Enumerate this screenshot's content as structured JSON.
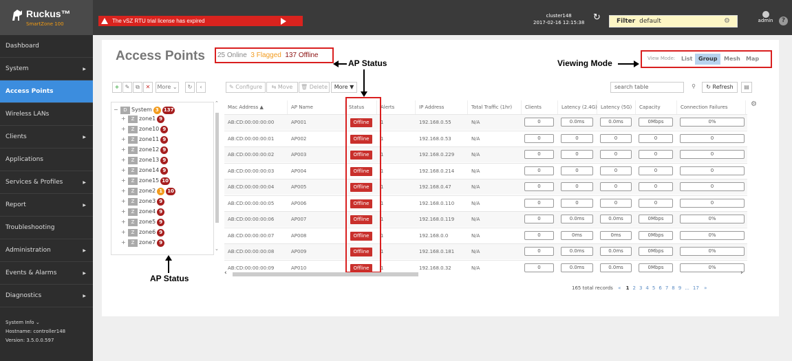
{
  "app": {
    "brand": "Ruckus™",
    "product": "SmartZone 100"
  },
  "alert": {
    "text": "The vSZ RTU trial license has expired"
  },
  "header": {
    "cluster": "cluster148",
    "datetime": "2017-02-16 12:15:38",
    "filter_label": "Filter",
    "filter_value": "default",
    "user": "admin"
  },
  "sidebar": {
    "items": [
      {
        "label": "Dashboard",
        "arrow": false
      },
      {
        "label": "System",
        "arrow": true
      },
      {
        "label": "Access Points",
        "arrow": false,
        "active": true
      },
      {
        "label": "Wireless LANs",
        "arrow": false
      },
      {
        "label": "Clients",
        "arrow": true
      },
      {
        "label": "Applications",
        "arrow": false
      },
      {
        "label": "Services & Profiles",
        "arrow": true
      },
      {
        "label": "Report",
        "arrow": true
      },
      {
        "label": "Troubleshooting",
        "arrow": false
      },
      {
        "label": "Administration",
        "arrow": true
      },
      {
        "label": "Events & Alarms",
        "arrow": true
      },
      {
        "label": "Diagnostics",
        "arrow": true
      }
    ],
    "sysinfo": {
      "title": "System Info",
      "hostname": "Hostname: controller148",
      "version": "Version:  3.5.0.0.597"
    }
  },
  "page": {
    "title": "Access Points",
    "online": "25 Online",
    "flagged": "3 Flagged",
    "offline": "137 Offline"
  },
  "annotations": {
    "ap_status_top": "AP Status",
    "ap_status_bottom": "AP Status",
    "viewing_mode": "Viewing Mode"
  },
  "view_mode": {
    "label": "View Mode:",
    "options": [
      "List",
      "Group",
      "Mesh",
      "Map"
    ],
    "selected": "Group"
  },
  "tree_toolbar": {
    "more": "More"
  },
  "tree": {
    "root": {
      "tag": "D",
      "name": "System",
      "flagged": "3",
      "offline": "137"
    },
    "zones": [
      {
        "name": "zone1",
        "flagged": "",
        "offline": "9"
      },
      {
        "name": "zone10",
        "flagged": "",
        "offline": "9"
      },
      {
        "name": "zone11",
        "flagged": "",
        "offline": "9"
      },
      {
        "name": "zone12",
        "flagged": "",
        "offline": "9"
      },
      {
        "name": "zone13",
        "flagged": "",
        "offline": "9"
      },
      {
        "name": "zone14",
        "flagged": "",
        "offline": "9"
      },
      {
        "name": "zone15",
        "flagged": "",
        "offline": "10"
      },
      {
        "name": "zone2",
        "flagged": "1",
        "offline": "10"
      },
      {
        "name": "zone3",
        "flagged": "",
        "offline": "9"
      },
      {
        "name": "zone4",
        "flagged": "",
        "offline": "9"
      },
      {
        "name": "zone5",
        "flagged": "",
        "offline": "9"
      },
      {
        "name": "zone6",
        "flagged": "",
        "offline": "9"
      },
      {
        "name": "zone7",
        "flagged": "",
        "offline": "9"
      }
    ]
  },
  "table_toolbar": {
    "configure": "Configure",
    "move": "Move",
    "delete": "Delete",
    "more": "More ▼",
    "search_placeholder": "search table",
    "refresh": "Refresh"
  },
  "table": {
    "headers": [
      "Mac Address ▲",
      "AP Name",
      "Status",
      "Alerts",
      "IP Address",
      "Total Traffic (1hr)",
      "Clients",
      "Latency (2.4G)",
      "Latency (5G)",
      "Capacity",
      "Connection Failures"
    ],
    "rows": [
      [
        "AB:CD:00:00:00:00",
        "AP001",
        "Offline",
        "1",
        "192.168.0.55",
        "N/A",
        "0",
        "0.0ms",
        "0.0ms",
        "0Mbps",
        "0%"
      ],
      [
        "AB:CD:00:00:00:01",
        "AP002",
        "Offline",
        "1",
        "192.168.0.53",
        "N/A",
        "0",
        "0",
        "0",
        "0",
        "0"
      ],
      [
        "AB:CD:00:00:00:02",
        "AP003",
        "Offline",
        "1",
        "192.168.0.229",
        "N/A",
        "0",
        "0",
        "0",
        "0",
        "0"
      ],
      [
        "AB:CD:00:00:00:03",
        "AP004",
        "Offline",
        "1",
        "192.168.0.214",
        "N/A",
        "0",
        "0",
        "0",
        "0",
        "0"
      ],
      [
        "AB:CD:00:00:00:04",
        "AP005",
        "Offline",
        "1",
        "192.168.0.47",
        "N/A",
        "0",
        "0",
        "0",
        "0",
        "0"
      ],
      [
        "AB:CD:00:00:00:05",
        "AP006",
        "Offline",
        "1",
        "192.168.0.110",
        "N/A",
        "0",
        "0",
        "0",
        "0",
        "0"
      ],
      [
        "AB:CD:00:00:00:06",
        "AP007",
        "Offline",
        "1",
        "192.168.0.119",
        "N/A",
        "0",
        "0.0ms",
        "0.0ms",
        "0Mbps",
        "0%"
      ],
      [
        "AB:CD:00:00:00:07",
        "AP008",
        "Offline",
        "1",
        "192.168.0.0",
        "N/A",
        "0",
        "0ms",
        "0ms",
        "0Mbps",
        "0%"
      ],
      [
        "AB:CD:00:00:00:08",
        "AP009",
        "Offline",
        "1",
        "192.168.0.181",
        "N/A",
        "0",
        "0.0ms",
        "0.0ms",
        "0Mbps",
        "0%"
      ],
      [
        "AB:CD:00:00:00:09",
        "AP010",
        "Offline",
        "1",
        "192.168.0.32",
        "N/A",
        "0",
        "0.0ms",
        "0.0ms",
        "0Mbps",
        "0%"
      ]
    ]
  },
  "pager": {
    "total": "165 total records",
    "prev": "«",
    "pages": [
      "1",
      "2",
      "3",
      "4",
      "5",
      "6",
      "7",
      "8",
      "9",
      "...",
      "17"
    ],
    "next": "»"
  },
  "colors": {
    "accent": "#3c8dde",
    "alert": "#d9231e",
    "offline": "#a61e1e",
    "flagged": "#f29b1e",
    "annotation_box": "#d91f1f"
  }
}
